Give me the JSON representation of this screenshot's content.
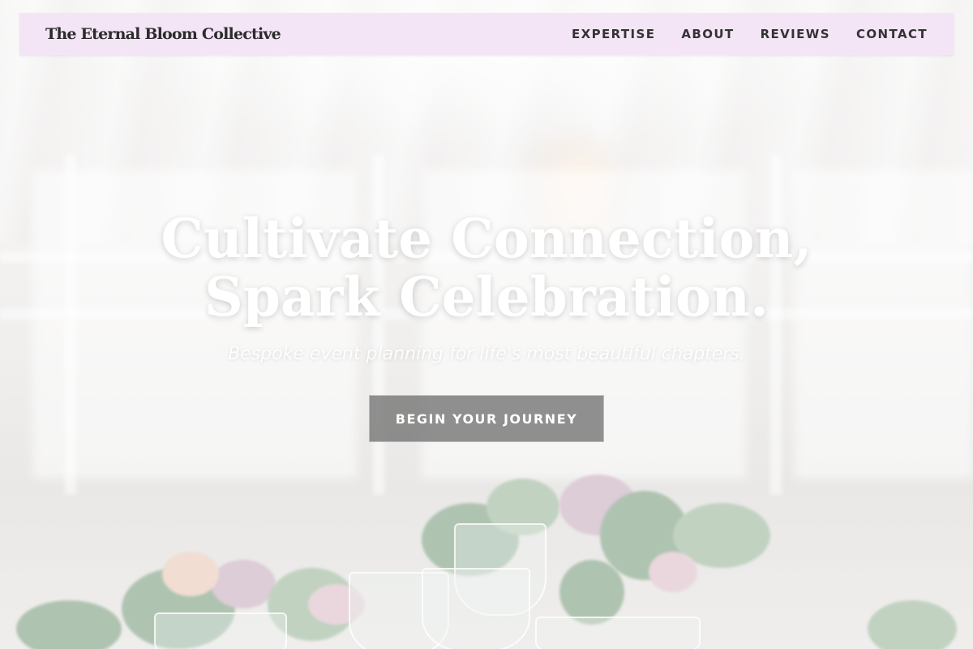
{
  "header": {
    "brand": "The Eternal Bloom Collective",
    "nav": [
      {
        "label": "EXPERTISE"
      },
      {
        "label": "ABOUT"
      },
      {
        "label": "REVIEWS"
      },
      {
        "label": "CONTACT"
      }
    ]
  },
  "hero": {
    "title_line1": "Cultivate Connection,",
    "title_line2": "Spark Celebration.",
    "subtitle": "Bespoke event planning for life's most beautiful chapters.",
    "cta_label": "BEGIN YOUR JOURNEY"
  },
  "colors": {
    "nav_background": "#f3e4f6",
    "cta_background": "#787878",
    "text_dark": "#2b2b2b"
  }
}
